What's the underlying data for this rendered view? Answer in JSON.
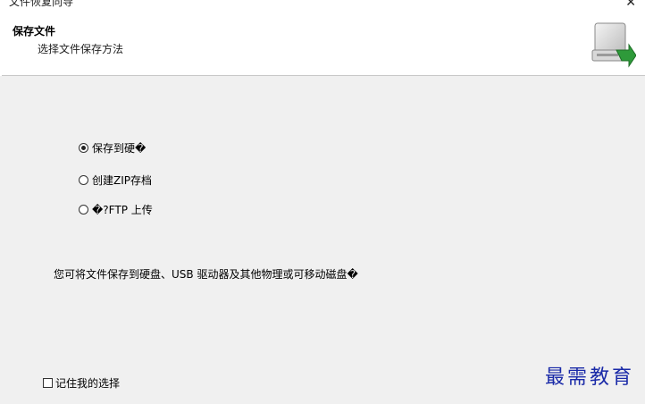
{
  "window": {
    "title": "文件恢复向导",
    "close_glyph": "✕"
  },
  "header": {
    "title": "保存文件",
    "subtitle": "选择文件保存方法",
    "icon": "disk-drive-icon"
  },
  "options": [
    {
      "label": "保存到硬�",
      "selected": true
    },
    {
      "label": "创建ZIP存档",
      "selected": false
    },
    {
      "label": "�?FTP 上传",
      "selected": false
    }
  ],
  "description": "您可将文件保存到硬盘、USB 驱动器及其他物理或可移动磁盘�",
  "remember": {
    "label": "记住我的选择",
    "checked": false
  },
  "watermark": "最需教育",
  "colors": {
    "watermark": "#1a2aa8",
    "icon_arrow": "#2e9a3a"
  }
}
